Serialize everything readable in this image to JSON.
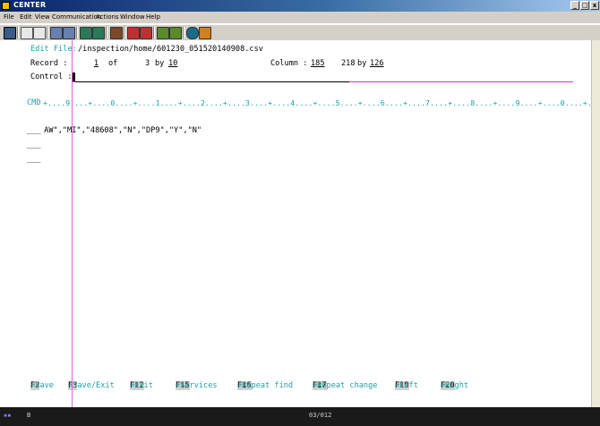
{
  "window": {
    "title": "CENTER"
  },
  "menu": [
    "File",
    "Edit",
    "View",
    "Communication",
    "Actions",
    "Window",
    "Help"
  ],
  "editor": {
    "edit_file_label": "Edit File:",
    "file_path": "/inspection/home/601230_051520140908.csv",
    "record_label": "Record :",
    "record_value": "1",
    "of_label": "of",
    "record_total": "3",
    "by_label": "by",
    "record_width": "10",
    "column_label": "Column :",
    "column_value": "185",
    "col_total": "218",
    "by_label2": "by",
    "col_width": "126",
    "control_label": "Control :"
  },
  "ruler": {
    "label": "CMD",
    "scale": "+....9....+....0....+....1....+....2....+....3....+....4....+....5....+....6....+....7....+....8....+....9....+....0....+....1."
  },
  "rows": [
    {
      "prefix": "___",
      "text": " AW\",\"MI\",\"48608\",\"N\",\"DP9\",\"Y\",\"N\""
    },
    {
      "prefix": "___",
      "text": ""
    },
    {
      "prefix": "___",
      "text": ""
    }
  ],
  "function_keys": [
    {
      "key": "F2",
      "label": "=Save"
    },
    {
      "key": "F3",
      "label": "=Save/Exit"
    },
    {
      "key": "F12",
      "label": "=Exit"
    },
    {
      "key": "F15",
      "label": "=Services"
    },
    {
      "key": "F16",
      "label": "=Repeat find"
    },
    {
      "key": "F17",
      "label": "=Repeat change"
    },
    {
      "key": "F19",
      "label": "=Left"
    },
    {
      "key": "F20",
      "label": "=Right"
    }
  ],
  "status": {
    "mode": "B",
    "position": "03/012"
  }
}
